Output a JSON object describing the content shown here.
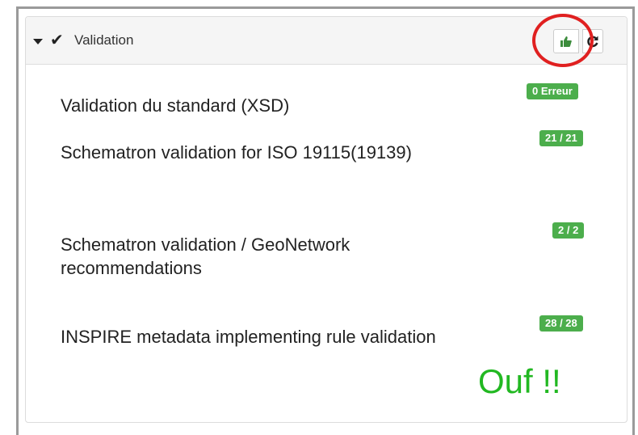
{
  "panel": {
    "title": "Validation",
    "thumb_icon": "thumbs-up-icon",
    "refresh_icon": "refresh-icon",
    "accent_color": "#4cae4c"
  },
  "rows": [
    {
      "label": "Validation du standard (XSD)",
      "badge": "0 Erreur"
    },
    {
      "label": "Schematron validation for ISO 19115(19139)",
      "badge": "21 / 21"
    },
    {
      "label": "Schematron validation / GeoNetwork recommendations",
      "badge": "2 / 2"
    },
    {
      "label": "INSPIRE metadata implementing rule validation",
      "badge": "28 / 28"
    }
  ],
  "annotation": {
    "text": "Ouf !!",
    "highlight_color": "#e02020"
  }
}
